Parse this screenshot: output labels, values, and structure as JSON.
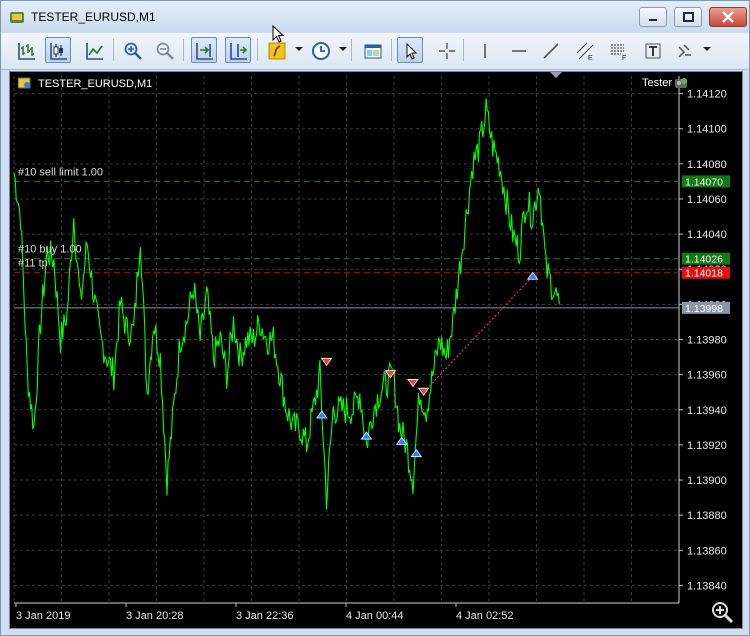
{
  "window": {
    "title": "TESTER_EURUSD,M1"
  },
  "toolbar": {
    "items": [
      {
        "name": "bar-chart-icon",
        "active": false
      },
      {
        "name": "candlestick-chart-icon",
        "active": true
      },
      {
        "name": "line-chart-icon",
        "active": false
      },
      {
        "name": "zoom-in-icon",
        "active": false
      },
      {
        "name": "zoom-out-icon",
        "active": false
      },
      {
        "name": "chart-shift-icon",
        "active": true
      },
      {
        "name": "autoscroll-icon",
        "active": true
      },
      {
        "name": "indicators-icon",
        "active": false
      },
      {
        "name": "timeframes-icon",
        "active": false
      },
      {
        "name": "templates-icon",
        "active": false
      },
      {
        "name": "cursor-icon",
        "active": true
      },
      {
        "name": "crosshair-icon",
        "active": false
      },
      {
        "name": "vertical-line-icon",
        "active": false
      },
      {
        "name": "horizontal-line-icon",
        "active": false
      },
      {
        "name": "trendline-icon",
        "active": false
      },
      {
        "name": "equidistant-channel-icon",
        "active": false
      },
      {
        "name": "fibonacci-icon",
        "active": false
      },
      {
        "name": "text-label-icon",
        "active": false
      },
      {
        "name": "arrows-icon",
        "active": false
      }
    ]
  },
  "chart": {
    "title": "TESTER_EURUSD,M1",
    "tester_label": "Tester",
    "colors": {
      "background": "#000000",
      "price": "#00ff00",
      "grid": "#3c3c3c",
      "sell": "#ff3b2f",
      "buy": "#2a7fff"
    },
    "order_labels": [
      {
        "text": "#10 sell limit 1.00",
        "price": 1.1407
      },
      {
        "text": "#10 buy 1.00",
        "price": 1.14026
      },
      {
        "text": "#11 tp",
        "price": 1.14018
      }
    ],
    "price_tags": [
      {
        "text": "1.14070",
        "price": 1.1407,
        "color": "#127a12"
      },
      {
        "text": "1.14026",
        "price": 1.14026,
        "color": "#127a12"
      },
      {
        "text": "1.14018",
        "price": 1.14018,
        "color": "#e11010"
      },
      {
        "text": "1.13998",
        "price": 1.13998,
        "color": "#8a96a3"
      }
    ],
    "x_labels": [
      "3 Jan 2019",
      "3 Jan 20:28",
      "3 Jan 22:36",
      "4 Jan 00:44",
      "4 Jan 02:52"
    ]
  },
  "chart_data": {
    "type": "line",
    "y_ticks": [
      "1.14120",
      "1.14100",
      "1.14080",
      "1.14060",
      "1.14040",
      "1.14020",
      "1.14000",
      "1.13980",
      "1.13960",
      "1.13940",
      "1.13920",
      "1.13900",
      "1.13880",
      "1.13860",
      "1.13840"
    ],
    "ylim": [
      1.1383,
      1.1413
    ],
    "x_range": [
      0,
      100
    ],
    "series": [
      {
        "x": [
          0,
          1,
          2,
          3,
          4,
          5,
          6,
          7,
          8,
          9,
          10,
          11,
          12,
          13,
          14,
          15,
          16,
          17,
          18,
          19,
          20,
          21,
          22,
          23,
          24,
          25,
          26,
          27,
          28,
          29,
          30,
          31,
          32,
          33,
          34,
          35,
          36,
          37,
          38,
          39,
          40,
          41,
          42,
          43,
          44,
          45,
          46,
          47,
          48,
          49,
          50,
          51,
          52,
          53,
          54,
          55,
          56,
          57,
          58,
          59,
          60,
          61,
          62,
          63,
          64,
          65,
          66,
          67,
          68,
          69,
          70,
          71,
          72,
          73,
          74,
          75,
          76,
          77,
          78,
          79,
          80,
          81,
          82
        ],
        "values": [
          1.14075,
          1.1405,
          1.1396,
          1.1393,
          1.1399,
          1.1403,
          1.14025,
          1.1398,
          1.13995,
          1.1405,
          1.14,
          1.14035,
          1.14005,
          1.1398,
          1.1397,
          1.1396,
          1.14,
          1.13985,
          1.13985,
          1.1404,
          1.1395,
          1.1399,
          1.1397,
          1.139,
          1.1394,
          1.1398,
          1.1399,
          1.1401,
          1.1398,
          1.14005,
          1.1397,
          1.1398,
          1.1396,
          1.1399,
          1.1397,
          1.1398,
          1.1398,
          1.1399,
          1.1398,
          1.1398,
          1.1396,
          1.1394,
          1.1393,
          1.1393,
          1.1392,
          1.1394,
          1.1396,
          1.1389,
          1.1394,
          1.1394,
          1.1394,
          1.1394,
          1.1395,
          1.1392,
          1.1394,
          1.1395,
          1.13955,
          1.1396,
          1.1393,
          1.1392,
          1.139,
          1.1395,
          1.1394,
          1.1396,
          1.1398,
          1.1397,
          1.1399,
          1.1402,
          1.1405,
          1.1408,
          1.1409,
          1.1411,
          1.1409,
          1.1408,
          1.1406,
          1.1404,
          1.1403,
          1.1406,
          1.1405,
          1.1407,
          1.1402,
          1.1401,
          1.14
        ]
      }
    ],
    "trade_markers": [
      {
        "type": "sell",
        "x": 47,
        "y": 1.13967
      },
      {
        "type": "buy",
        "x": 46.3,
        "y": 1.13937
      },
      {
        "type": "buy",
        "x": 53,
        "y": 1.13925
      },
      {
        "type": "sell",
        "x": 56.6,
        "y": 1.1396
      },
      {
        "type": "buy",
        "x": 58.3,
        "y": 1.13922
      },
      {
        "type": "sell",
        "x": 60,
        "y": 1.13955
      },
      {
        "type": "buy",
        "x": 60.5,
        "y": 1.13915
      },
      {
        "type": "sell",
        "x": 61.6,
        "y": 1.1395
      },
      {
        "type": "buy",
        "x": 78,
        "y": 1.14016
      }
    ]
  }
}
